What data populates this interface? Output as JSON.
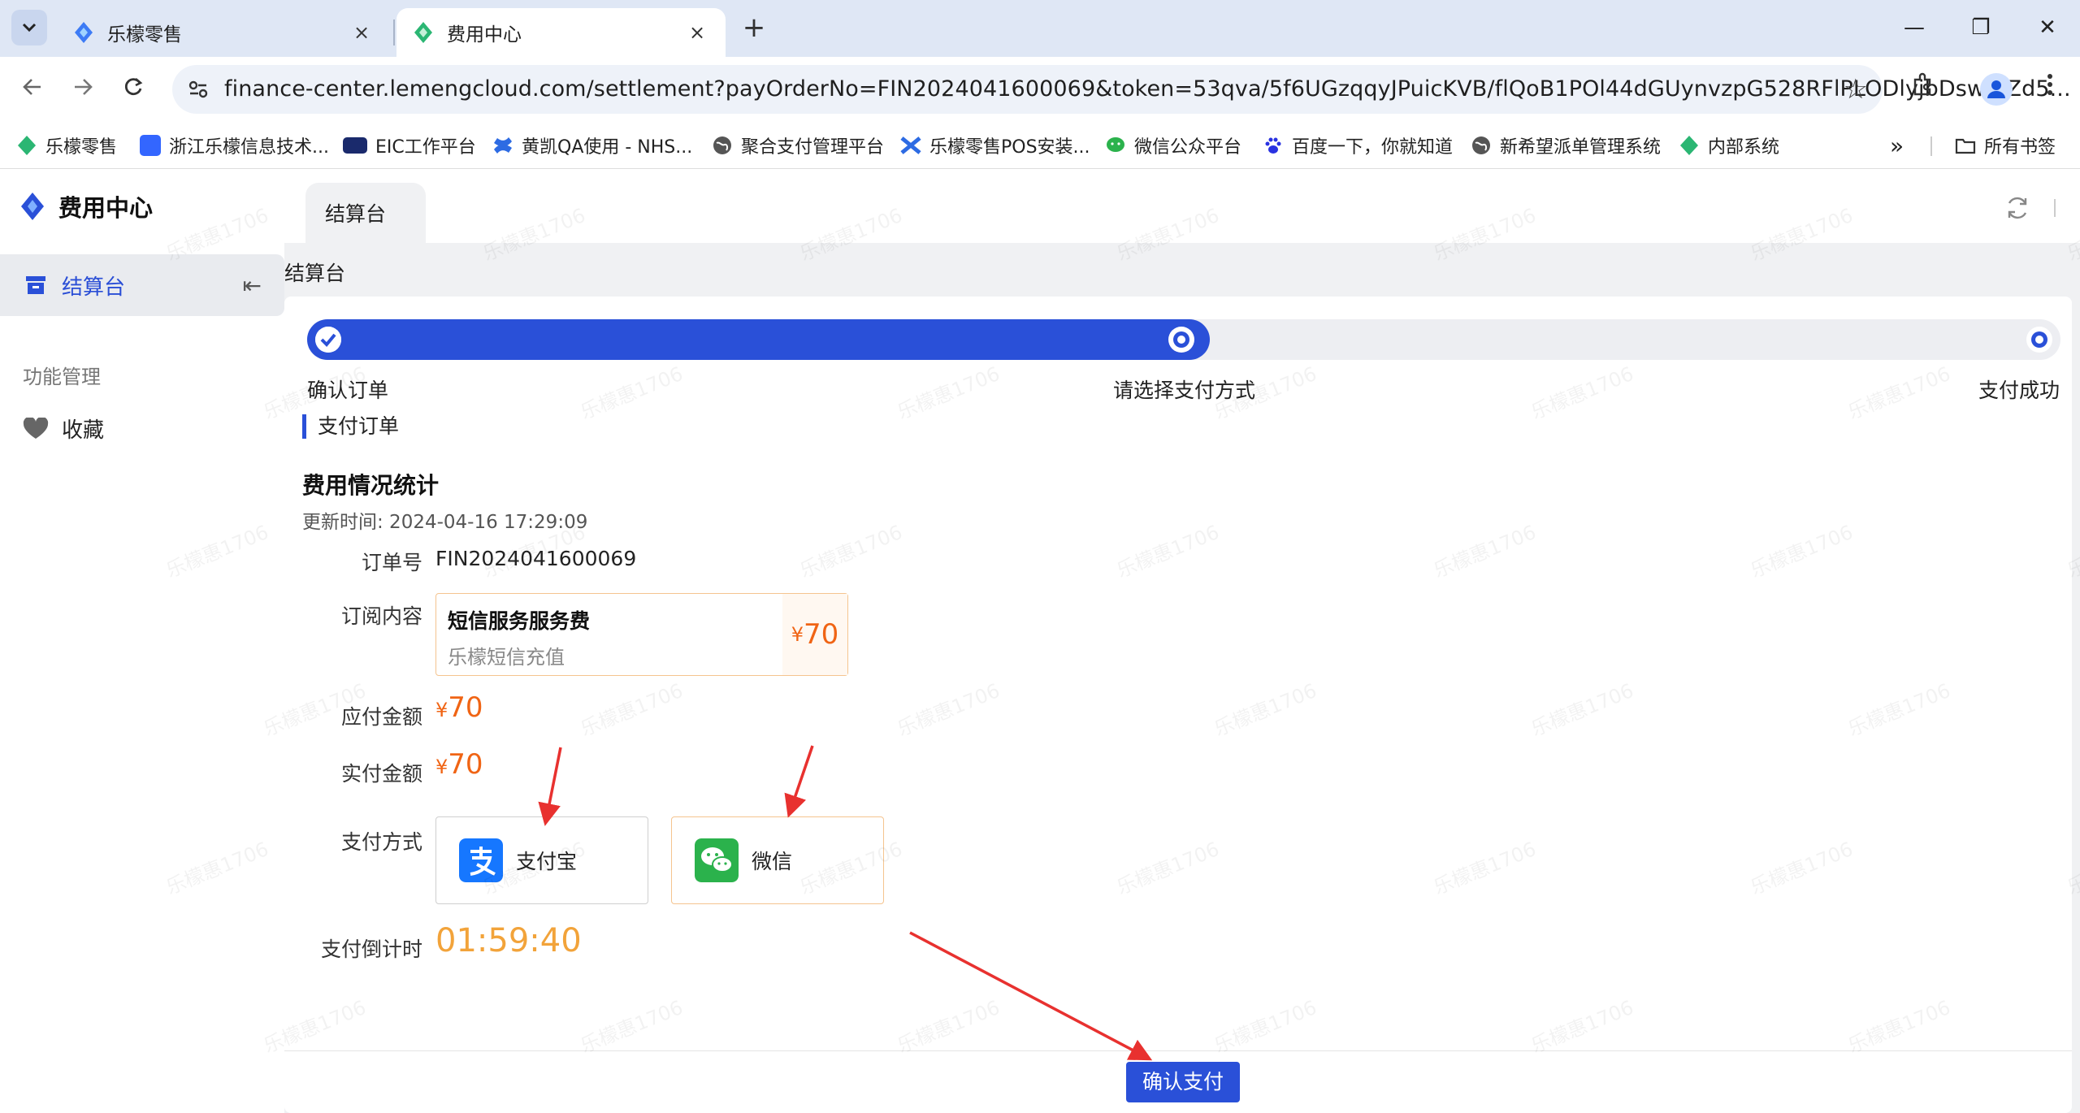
{
  "browser": {
    "tabs": [
      {
        "title": "乐檬零售",
        "close": "×"
      },
      {
        "title": "费用中心",
        "close": "×"
      }
    ],
    "new_tab": "+",
    "window": {
      "minimize": "—",
      "restore": "❐",
      "close": "✕"
    },
    "url": "finance-center.lemengcloud.com/settlement?payOrderNo=FIN2024041600069&token=53qva/5f6UGzqqyJPuicKVB/flQoB1POl44dGUynvzpG528RFlPLODlyjbDswmZd5...",
    "bookmarks": [
      {
        "label": "乐檬零售",
        "color": "#2bb673"
      },
      {
        "label": "浙江乐檬信息技术...",
        "color": "#3366ff"
      },
      {
        "label": "EIC工作平台",
        "color": "#1a2a6c"
      },
      {
        "label": "黄凯QA使用 - NHS...",
        "color": "#2d6be3"
      },
      {
        "label": "聚合支付管理平台",
        "color": "#555555"
      },
      {
        "label": "乐檬零售POS安装...",
        "color": "#2d6be3"
      },
      {
        "label": "微信公众平台",
        "color": "#2bb24c"
      },
      {
        "label": "百度一下，你就知道",
        "color": "#2932e1"
      },
      {
        "label": "新希望派单管理系统",
        "color": "#555555"
      },
      {
        "label": "内部系统",
        "color": "#2bb673"
      }
    ],
    "more_bookmarks": "»",
    "all_bookmarks": "所有书签"
  },
  "app": {
    "name": "费用中心",
    "page_tab": "结算台",
    "sidebar": {
      "active_item": "结算台",
      "group_label": "功能管理",
      "favorites": "收藏"
    },
    "breadcrumb": "结算台",
    "steps": [
      {
        "label": "确认订单",
        "state": "done"
      },
      {
        "label": "请选择支付方式",
        "state": "current"
      },
      {
        "label": "支付成功",
        "state": "pending"
      }
    ],
    "progress_fraction": 0.515,
    "section_title": "支付订单",
    "stats_title": "费用情况统计",
    "update_time": "更新时间: 2024-04-16 17:29:09",
    "order": {
      "order_no_label": "订单号",
      "order_no": "FIN2024041600069",
      "subscription_label": "订阅内容",
      "item_name": "短信服务服务费",
      "item_desc": "乐檬短信充值",
      "item_price_symbol": "¥",
      "item_price": "70",
      "payable_label": "应付金额",
      "payable_symbol": "¥",
      "payable": "70",
      "actual_label": "实付金额",
      "actual_symbol": "¥",
      "actual": "70",
      "method_label": "支付方式",
      "methods": [
        {
          "name": "支付宝",
          "icon": "alipay-icon",
          "color": "#1677ff"
        },
        {
          "name": "微信",
          "icon": "wechat-icon",
          "color": "#2bb24c"
        }
      ],
      "countdown_label": "支付倒计时",
      "countdown": "01:59:40"
    },
    "confirm_button": "确认支付",
    "watermark": "乐檬惠1706",
    "accent_color": "#2a50d8",
    "price_color": "#f06414"
  }
}
